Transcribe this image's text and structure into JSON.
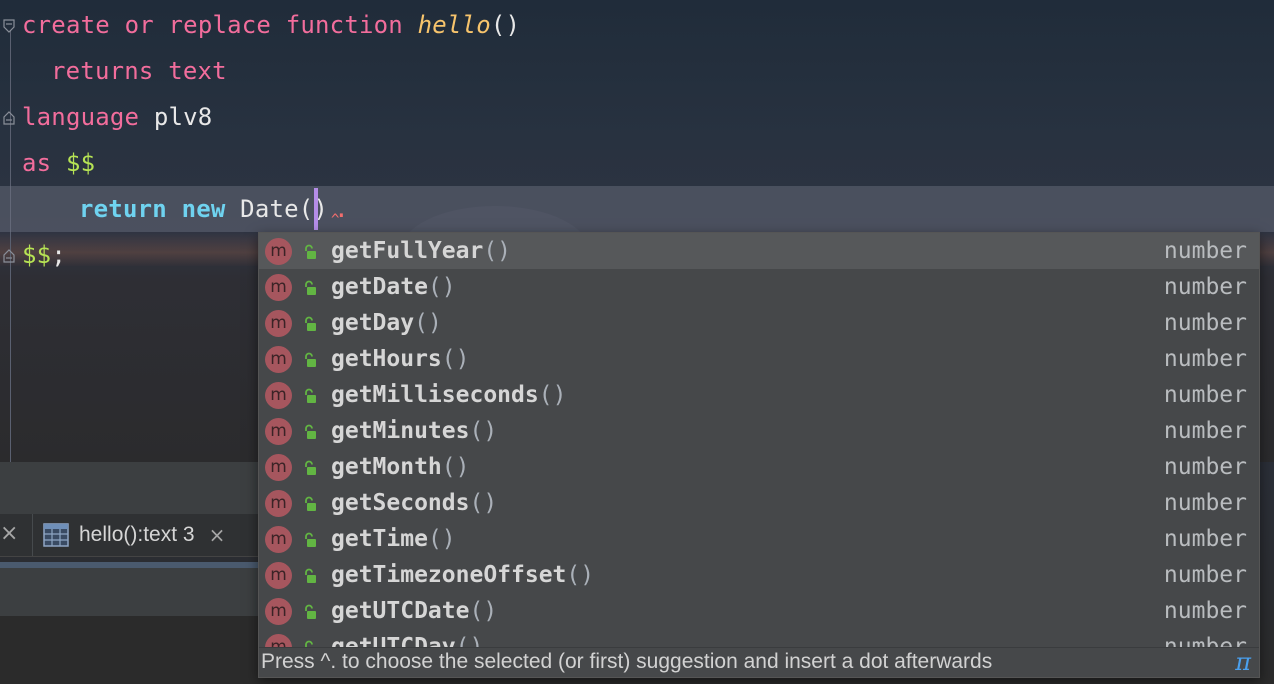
{
  "editor": {
    "line1": {
      "create": "create",
      "or": "or",
      "replace": "replace",
      "function": "function",
      "name": "hello",
      "parens": "()"
    },
    "line2": {
      "returns": "returns",
      "type": "text"
    },
    "line3": {
      "language": "language",
      "lang": "plv8"
    },
    "line4": {
      "as": "as",
      "dollars": "$$"
    },
    "line5": {
      "return": "return",
      "new": "new",
      "call": "Date()",
      "dot": "."
    },
    "line6": {
      "end": "$$",
      "semi": ";"
    }
  },
  "console_tab": {
    "label": "hello():text 3",
    "close_left": "×",
    "close": "×",
    "icon": "table-icon"
  },
  "completion": {
    "items": [
      {
        "name": "getFullYear",
        "parens": "()",
        "type": "number",
        "selected": true
      },
      {
        "name": "getDate",
        "parens": "()",
        "type": "number"
      },
      {
        "name": "getDay",
        "parens": "()",
        "type": "number"
      },
      {
        "name": "getHours",
        "parens": "()",
        "type": "number"
      },
      {
        "name": "getMilliseconds",
        "parens": "()",
        "type": "number"
      },
      {
        "name": "getMinutes",
        "parens": "()",
        "type": "number"
      },
      {
        "name": "getMonth",
        "parens": "()",
        "type": "number"
      },
      {
        "name": "getSeconds",
        "parens": "()",
        "type": "number"
      },
      {
        "name": "getTime",
        "parens": "()",
        "type": "number"
      },
      {
        "name": "getTimezoneOffset",
        "parens": "()",
        "type": "number"
      },
      {
        "name": "getUTCDate",
        "parens": "()",
        "type": "number"
      },
      {
        "name": "getUTCDay",
        "parens": "()",
        "type": "number"
      }
    ],
    "method_badge": "m",
    "hint": "Press ^. to choose the selected (or first) suggestion and insert a dot afterwards",
    "pi": "π"
  },
  "colors": {
    "keyword": "#f26d9c",
    "keyword_js": "#6fd3f0",
    "function_name": "#f7c46c",
    "dollar": "#b6e354",
    "method_badge": "#a6565e",
    "hint_icon": "#4aa0ee"
  }
}
